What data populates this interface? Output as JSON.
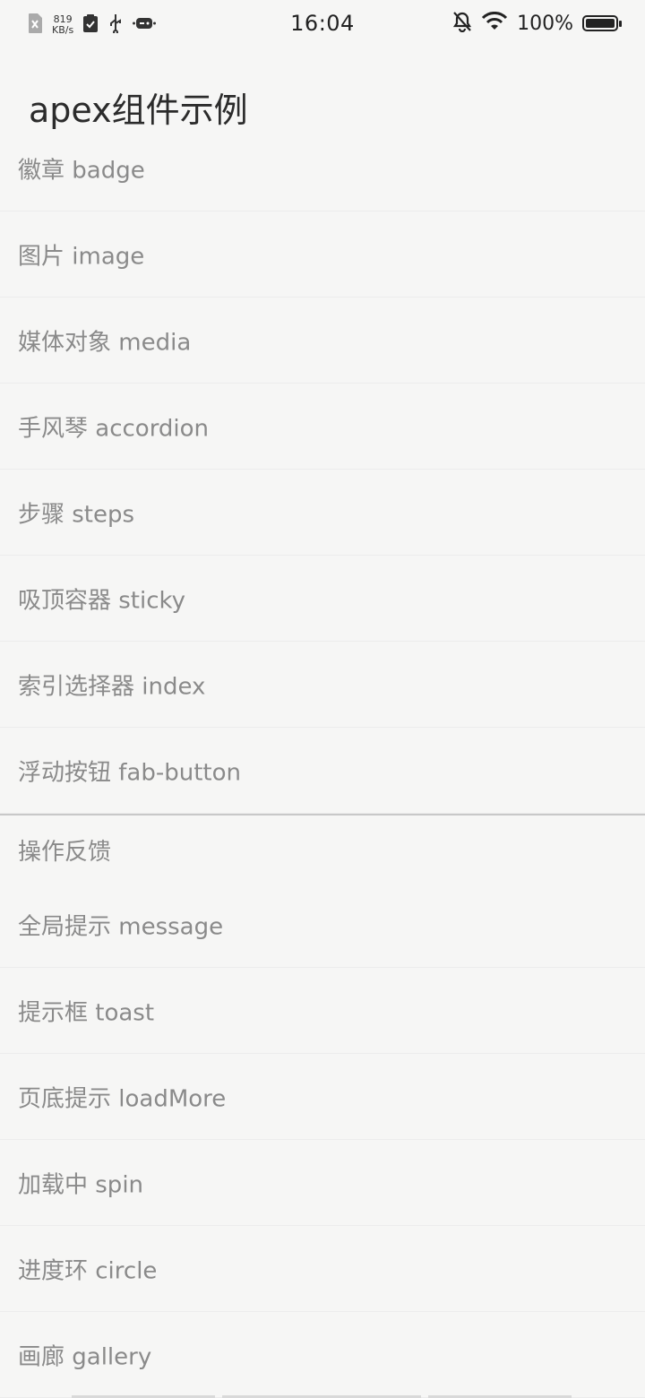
{
  "status_bar": {
    "speed_value": "819",
    "speed_unit": "KB/s",
    "time": "16:04",
    "battery_percent": "100%",
    "battery_level": 1.0
  },
  "header": {
    "title": "apex组件示例"
  },
  "list_top": [
    {
      "label": "徽章 badge"
    },
    {
      "label": "图片 image"
    },
    {
      "label": "媒体对象 media"
    },
    {
      "label": "手风琴 accordion"
    },
    {
      "label": "步骤 steps"
    },
    {
      "label": "吸顶容器 sticky"
    },
    {
      "label": "索引选择器 index"
    },
    {
      "label": "浮动按钮 fab-button"
    }
  ],
  "section": {
    "title": "操作反馈"
  },
  "list_feedback": [
    {
      "label": "全局提示 message"
    },
    {
      "label": "提示框 toast"
    },
    {
      "label": "页底提示 loadMore"
    },
    {
      "label": "加载中 spin"
    },
    {
      "label": "进度环 circle"
    },
    {
      "label": "画廊 gallery"
    }
  ]
}
